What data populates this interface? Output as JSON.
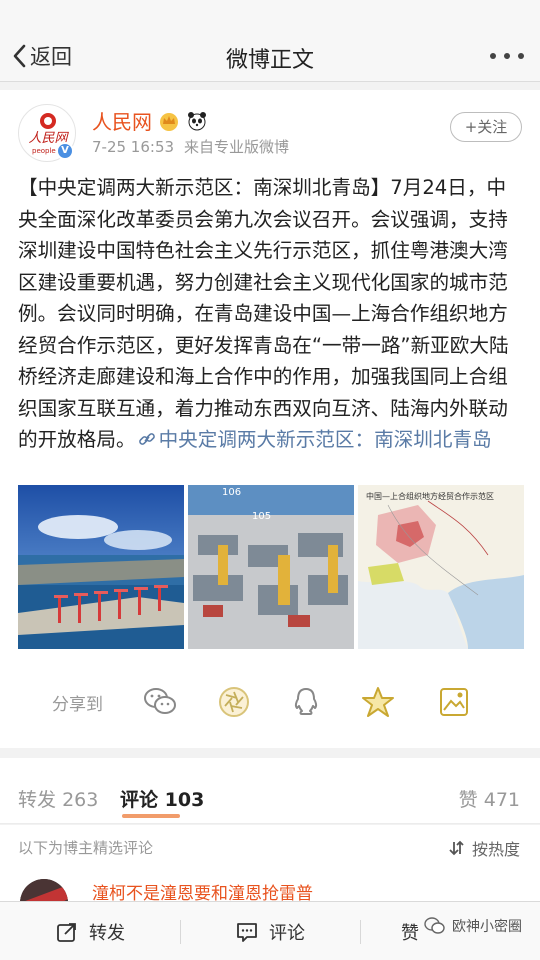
{
  "nav": {
    "back_label": "返回",
    "title": "微博正文"
  },
  "post": {
    "author": "人民网",
    "avatar_text": "人民网",
    "avatar_sub": "people.",
    "time": "7-25 16:53",
    "source": "来自专业版微博",
    "follow_label": "+关注",
    "text": "【中央定调两大新示范区：南深圳北青岛】7月24日，中央全面深化改革委员会第九次会议召开。会议强调，支持深圳建设中国特色社会主义先行示范区，抓住粤港澳大湾区建设重要机遇，努力创建社会主义现代化国家的城市范例。会议同时明确，在青岛建设中国—上海合作组织地方经贸合作示范区，更好发挥青岛在“一带一路”新亚欧大陆桥经济走廊建设和海上合作中的作用，加强我国同上合组织国家互联互通，着力推动东西双向互济、陆海内外联动的开放格局。",
    "link_text": "中央定调两大新示范区：南深圳北青岛",
    "image2_numbers": [
      "106",
      "105"
    ],
    "image3_title": "中国—上合组织地方经贸合作示范区"
  },
  "share": {
    "label": "分享到",
    "icons": [
      "wechat-icon",
      "moments-icon",
      "qq-icon",
      "qzone-icon",
      "save-image-icon"
    ]
  },
  "tabs": {
    "repost_label": "转发",
    "repost_count": "263",
    "comment_label": "评论",
    "comment_count": "103",
    "like_label": "赞",
    "like_count": "471"
  },
  "comments": {
    "note": "以下为博主精选评论",
    "sort_label": "按热度",
    "first_name": "潼柯不是潼恩要和潼恩抢雷普"
  },
  "bottom": {
    "repost_label": "转发",
    "comment_label": "评论",
    "like_label": "赞",
    "watermark": "欧神小密圈"
  },
  "colors": {
    "accent_orange": "#e8531f",
    "link_blue": "#5a7ba6",
    "tab_underline": "#f19c6b"
  }
}
